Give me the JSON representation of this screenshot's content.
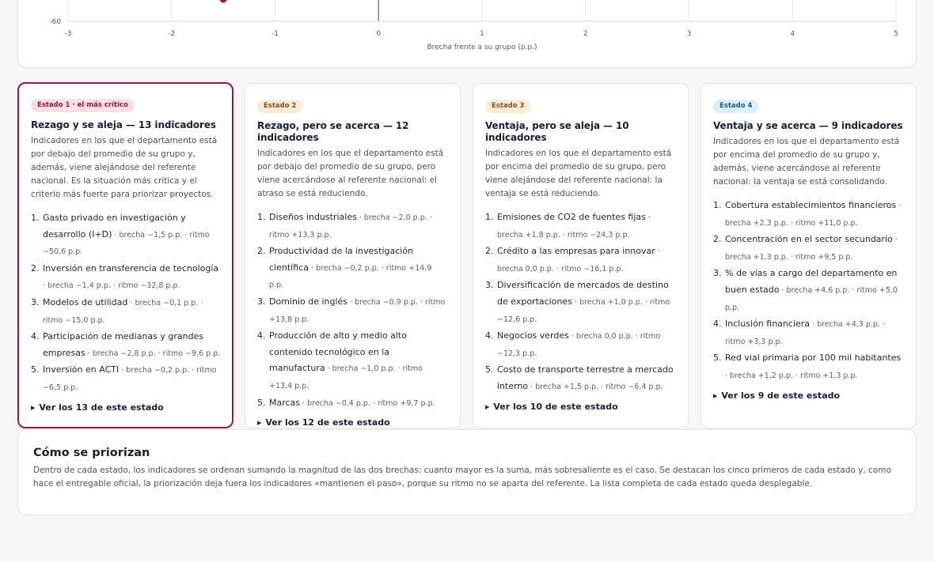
{
  "chart_data": {
    "type": "scatter",
    "xlabel": "Brecha frente a su grupo (p.p.)",
    "x_ticks": [
      "-3",
      "-2",
      "-1",
      "0",
      "1",
      "2",
      "3",
      "4",
      "5"
    ],
    "x_tick_values": [
      -3,
      -2,
      -1,
      0,
      1,
      2,
      3,
      4,
      5
    ],
    "y_ticks_visible": [
      "-60"
    ],
    "xlim": [
      -3,
      5
    ],
    "grid": true,
    "points_visible": [
      {
        "x": -1.5,
        "y": -50.6,
        "color": "#8c1d40"
      }
    ]
  },
  "colors": {
    "accent_critical": "#8c1d40",
    "badge1_bg": "#f7dfe4",
    "badge1_fg": "#8c1d40",
    "badge2_bg": "#fbead6",
    "badge2_fg": "#8a5518",
    "badge3_bg": "#fbead6",
    "badge3_fg": "#8a5518",
    "badge4_bg": "#dcf0fb",
    "badge4_fg": "#1c5c86"
  },
  "cards": [
    {
      "badge": "Estado 1 · el más crítico",
      "title": "Rezago y se aleja — 13 indicadores",
      "desc": "Indicadores en los que el departamento está por debajo del promedio de su grupo y, además, viene alejándose del referente nacional. Es la situación más crítica y el criterio más fuerte para priorizar proyectos.",
      "items": [
        {
          "num": "1.",
          "name": "Gasto privado en investigación y desarrollo (I+D)",
          "meta": " · brecha −1,5 p.p. · ritmo −50,6 p.p."
        },
        {
          "num": "2.",
          "name": "Inversión en transferencia de tecnología",
          "meta": " · brecha −1,4 p.p. · ritmo −32,8 p.p."
        },
        {
          "num": "3.",
          "name": "Modelos de utilidad",
          "meta": " · brecha −0,1 p.p. · ritmo −15,0 p.p."
        },
        {
          "num": "4.",
          "name": "Participación de medianas y grandes empresas",
          "meta": " · brecha −2,8 p.p. · ritmo −9,6 p.p."
        },
        {
          "num": "5.",
          "name": "Inversión en ACTI",
          "meta": " · brecha −0,2 p.p. · ritmo −6,5 p.p."
        }
      ],
      "toggle": "Ver los 13 de este estado"
    },
    {
      "badge": "Estado 2",
      "title": "Rezago, pero se acerca — 12 indicadores",
      "desc": "Indicadores en los que el departamento está por debajo del promedio de su grupo, pero viene acercándose al referente nacional: el atraso se está reduciendo.",
      "items": [
        {
          "num": "1.",
          "name": "Diseños industriales",
          "meta": " · brecha −2,0 p.p. · ritmo +13,3 p.p."
        },
        {
          "num": "2.",
          "name": "Productividad de la investigación científica",
          "meta": " · brecha −0,2 p.p. · ritmo +14,9 p.p."
        },
        {
          "num": "3.",
          "name": "Dominio de inglés",
          "meta": " · brecha −0,9 p.p. · ritmo +13,8 p.p."
        },
        {
          "num": "4.",
          "name": "Producción de alto y medio alto contenido tecnológico en la manufactura",
          "meta": " · brecha −1,0 p.p. · ritmo +13,4 p.p."
        },
        {
          "num": "5.",
          "name": "Marcas",
          "meta": " · brecha −0,4 p.p. · ritmo +9,7 p.p."
        }
      ],
      "toggle": "Ver los 12 de este estado"
    },
    {
      "badge": "Estado 3",
      "title": "Ventaja, pero se aleja — 10 indicadores",
      "desc": "Indicadores en los que el departamento está por encima del promedio de su grupo, pero viene alejándose del referente nacional: la ventaja se está reduciendo.",
      "items": [
        {
          "num": "1.",
          "name": "Emisiones de CO2 de fuentes fijas",
          "meta": " · brecha +1,8 p.p. · ritmo −24,3 p.p."
        },
        {
          "num": "2.",
          "name": "Crédito a las empresas para innovar",
          "meta": " · brecha 0,0 p.p. · ritmo −16,1 p.p."
        },
        {
          "num": "3.",
          "name": "Diversificación de mercados de destino de exportaciones",
          "meta": " · brecha +1,0 p.p. · ritmo −12,6 p.p."
        },
        {
          "num": "4.",
          "name": "Negocios verdes",
          "meta": " · brecha 0,0 p.p. · ritmo −12,3 p.p."
        },
        {
          "num": "5.",
          "name": "Costo de transporte terrestre a mercado interno",
          "meta": " · brecha +1,5 p.p. · ritmo −6,4 p.p."
        }
      ],
      "toggle": "Ver los 10 de este estado"
    },
    {
      "badge": "Estado 4",
      "title": "Ventaja y se acerca — 9 indicadores",
      "desc": "Indicadores en los que el departamento está por encima del promedio de su grupo y, además, viene acercándose al referente nacional: la ventaja se está consolidando.",
      "items": [
        {
          "num": "1.",
          "name": "Cobertura establecimientos financieros",
          "meta": " · brecha +2,3 p.p. · ritmo +11,0 p.p."
        },
        {
          "num": "2.",
          "name": "Concentración en el sector secundario",
          "meta": " · brecha +1,3 p.p. · ritmo +9,5 p.p."
        },
        {
          "num": "3.",
          "name": "% de vías a cargo del departamento en buen estado",
          "meta": " · brecha +4,6 p.p. · ritmo +5,0 p.p."
        },
        {
          "num": "4.",
          "name": "Inclusión financiera",
          "meta": " · brecha +4,3 p.p. · ritmo +3,3 p.p."
        },
        {
          "num": "5.",
          "name": "Red vial primaria por 100 mil habitantes",
          "meta": " · brecha +1,2 p.p. · ritmo +1,3 p.p."
        }
      ],
      "toggle": "Ver los 9 de este estado"
    }
  ],
  "info": {
    "title": "Cómo se priorizan",
    "text": "Dentro de cada estado, los indicadores se ordenan sumando la magnitud de las dos brechas: cuanto mayor es la suma, más sobresaliente es el caso. Se destacan los cinco primeros de cada estado y, como hace el entregable oficial, la priorización deja fuera los indicadores «mantienen el paso», porque su ritmo no se aparta del referente. La lista completa de cada estado queda desplegable."
  }
}
